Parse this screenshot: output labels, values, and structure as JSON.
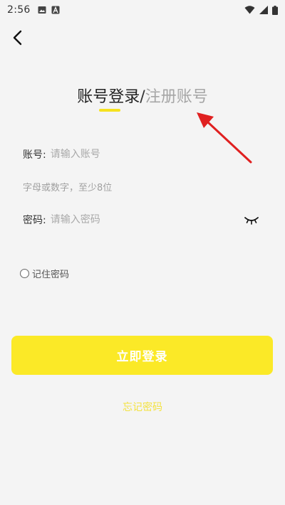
{
  "status_bar": {
    "time": "2:56",
    "left_icons": [
      "image-icon",
      "a-badge-icon"
    ],
    "right_icons": [
      "wifi-icon",
      "signal-icon",
      "battery-icon"
    ]
  },
  "header": {
    "tab_login": "账号登录",
    "separator": "/",
    "tab_register": "注册账号"
  },
  "form": {
    "account_label": "账号:",
    "account_placeholder": "请输入账号",
    "account_hint": "字母或数字，至少8位",
    "password_label": "密码:",
    "password_placeholder": "请输入密码",
    "remember_label": "记住密码"
  },
  "actions": {
    "login_label": "立即登录",
    "forgot_label": "忘记密码"
  },
  "colors": {
    "accent": "#fbe927",
    "annotation": "#e02020"
  }
}
